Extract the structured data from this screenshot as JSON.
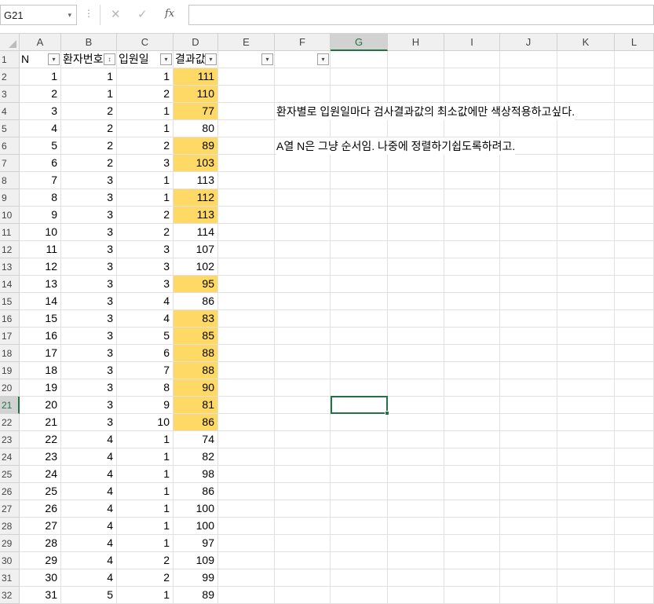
{
  "name_box": {
    "value": "G21",
    "arrow": "▾"
  },
  "formula_bar": {
    "dots": "⋮",
    "cancel": "✕",
    "enter": "✓",
    "fx": "fx",
    "content": ""
  },
  "columns": [
    "A",
    "B",
    "C",
    "D",
    "E",
    "F",
    "G",
    "H",
    "I",
    "J",
    "K",
    "L"
  ],
  "selected_column": "G",
  "selected_row": 21,
  "header_row": {
    "A": "N",
    "B": "환자번호",
    "C": "입원일",
    "D": "결과값"
  },
  "filter_icons": {
    "normal": "▾",
    "sorted": "↕"
  },
  "rows": [
    {
      "row": 2,
      "n": 1,
      "patient": 1,
      "day": 1,
      "value": 111,
      "hl": true
    },
    {
      "row": 3,
      "n": 2,
      "patient": 1,
      "day": 2,
      "value": 110,
      "hl": true
    },
    {
      "row": 4,
      "n": 3,
      "patient": 2,
      "day": 1,
      "value": 77,
      "hl": true
    },
    {
      "row": 5,
      "n": 4,
      "patient": 2,
      "day": 1,
      "value": 80,
      "hl": false
    },
    {
      "row": 6,
      "n": 5,
      "patient": 2,
      "day": 2,
      "value": 89,
      "hl": true
    },
    {
      "row": 7,
      "n": 6,
      "patient": 2,
      "day": 3,
      "value": 103,
      "hl": true
    },
    {
      "row": 8,
      "n": 7,
      "patient": 3,
      "day": 1,
      "value": 113,
      "hl": false
    },
    {
      "row": 9,
      "n": 8,
      "patient": 3,
      "day": 1,
      "value": 112,
      "hl": true
    },
    {
      "row": 10,
      "n": 9,
      "patient": 3,
      "day": 2,
      "value": 113,
      "hl": true
    },
    {
      "row": 11,
      "n": 10,
      "patient": 3,
      "day": 2,
      "value": 114,
      "hl": false
    },
    {
      "row": 12,
      "n": 11,
      "patient": 3,
      "day": 3,
      "value": 107,
      "hl": false
    },
    {
      "row": 13,
      "n": 12,
      "patient": 3,
      "day": 3,
      "value": 102,
      "hl": false
    },
    {
      "row": 14,
      "n": 13,
      "patient": 3,
      "day": 3,
      "value": 95,
      "hl": true
    },
    {
      "row": 15,
      "n": 14,
      "patient": 3,
      "day": 4,
      "value": 86,
      "hl": false
    },
    {
      "row": 16,
      "n": 15,
      "patient": 3,
      "day": 4,
      "value": 83,
      "hl": true
    },
    {
      "row": 17,
      "n": 16,
      "patient": 3,
      "day": 5,
      "value": 85,
      "hl": true
    },
    {
      "row": 18,
      "n": 17,
      "patient": 3,
      "day": 6,
      "value": 88,
      "hl": true
    },
    {
      "row": 19,
      "n": 18,
      "patient": 3,
      "day": 7,
      "value": 88,
      "hl": true
    },
    {
      "row": 20,
      "n": 19,
      "patient": 3,
      "day": 8,
      "value": 90,
      "hl": true
    },
    {
      "row": 21,
      "n": 20,
      "patient": 3,
      "day": 9,
      "value": 81,
      "hl": true
    },
    {
      "row": 22,
      "n": 21,
      "patient": 3,
      "day": 10,
      "value": 86,
      "hl": true
    },
    {
      "row": 23,
      "n": 22,
      "patient": 4,
      "day": 1,
      "value": 74,
      "hl": false
    },
    {
      "row": 24,
      "n": 23,
      "patient": 4,
      "day": 1,
      "value": 82,
      "hl": false
    },
    {
      "row": 25,
      "n": 24,
      "patient": 4,
      "day": 1,
      "value": 98,
      "hl": false
    },
    {
      "row": 26,
      "n": 25,
      "patient": 4,
      "day": 1,
      "value": 86,
      "hl": false
    },
    {
      "row": 27,
      "n": 26,
      "patient": 4,
      "day": 1,
      "value": 100,
      "hl": false
    },
    {
      "row": 28,
      "n": 27,
      "patient": 4,
      "day": 1,
      "value": 100,
      "hl": false
    },
    {
      "row": 29,
      "n": 28,
      "patient": 4,
      "day": 1,
      "value": 97,
      "hl": false
    },
    {
      "row": 30,
      "n": 29,
      "patient": 4,
      "day": 2,
      "value": 109,
      "hl": false
    },
    {
      "row": 31,
      "n": 30,
      "patient": 4,
      "day": 2,
      "value": 99,
      "hl": false
    },
    {
      "row": 32,
      "n": 31,
      "patient": 5,
      "day": 1,
      "value": 89,
      "hl": false
    }
  ],
  "notes": [
    {
      "row": 4,
      "text": "환자별로 입원일마다 검사결과값의 최소값에만 색상적용하고싶다."
    },
    {
      "row": 6,
      "text": "A열 N은 그냥 순서임. 나중에 정렬하기쉽도록하려고."
    }
  ],
  "colors": {
    "highlight": "#ffd966",
    "accent": "#217346"
  }
}
